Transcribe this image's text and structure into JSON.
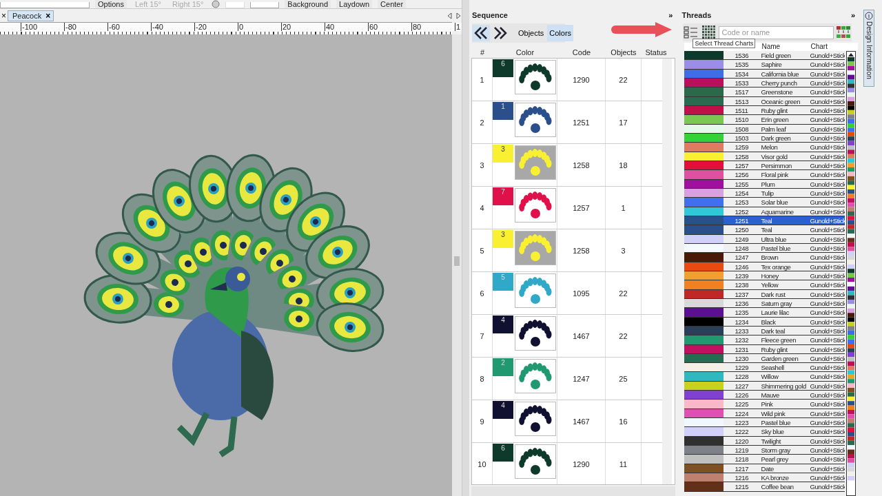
{
  "toolbar": {
    "items": [
      {
        "label": "Options",
        "disabled": false
      },
      {
        "label": "Left 15°",
        "disabled": true
      },
      {
        "label": "Right 15°",
        "disabled": true
      },
      {
        "label": "Background",
        "disabled": false
      },
      {
        "label": "Laydown",
        "disabled": false
      },
      {
        "label": "Center",
        "disabled": false
      }
    ]
  },
  "tab_bar": {
    "overflow_close": "×",
    "tabs": [
      {
        "label": "Peacock",
        "close": "×",
        "selected": true
      }
    ]
  },
  "ruler": {
    "labels": [
      "-100",
      "-80",
      "-60",
      "-40",
      "-20",
      "0",
      "20",
      "40",
      "60",
      "80",
      "1"
    ]
  },
  "sequence": {
    "title": "Sequence",
    "expand": "»",
    "views": [
      {
        "label": "Objects",
        "selected": false
      },
      {
        "label": "Colors",
        "selected": true
      }
    ],
    "columns": [
      "#",
      "Color",
      "Code",
      "Objects",
      "Status"
    ],
    "rows": [
      {
        "number": "1",
        "swatch_label": "6",
        "color": "#0d3a2a",
        "code": "1290",
        "objects": "22",
        "shaded": false
      },
      {
        "number": "2",
        "swatch_label": "1",
        "color": "#2a4f8a",
        "code": "1251",
        "objects": "17",
        "shaded": false
      },
      {
        "number": "3",
        "swatch_label": "3",
        "color": "#f8f030",
        "code": "1258",
        "objects": "18",
        "shaded": true
      },
      {
        "number": "4",
        "swatch_label": "7",
        "color": "#e0104a",
        "code": "1257",
        "objects": "1",
        "shaded": false
      },
      {
        "number": "5",
        "swatch_label": "3",
        "color": "#f8f030",
        "code": "1258",
        "objects": "3",
        "shaded": true
      },
      {
        "number": "6",
        "swatch_label": "5",
        "color": "#30a8c8",
        "code": "1095",
        "objects": "22",
        "shaded": false
      },
      {
        "number": "7",
        "swatch_label": "4",
        "color": "#101030",
        "code": "1467",
        "objects": "22",
        "shaded": false
      },
      {
        "number": "8",
        "swatch_label": "2",
        "color": "#209870",
        "code": "1247",
        "objects": "25",
        "shaded": false
      },
      {
        "number": "9",
        "swatch_label": "4",
        "color": "#101030",
        "code": "1467",
        "objects": "16",
        "shaded": false
      },
      {
        "number": "10",
        "swatch_label": "6",
        "color": "#0d3a2a",
        "code": "1290",
        "objects": "11",
        "shaded": false
      }
    ]
  },
  "threads": {
    "title": "Threads",
    "expand": "»",
    "search": {
      "placeholder": "Code or name"
    },
    "tooltip": "Select Thread Charts",
    "columns": [
      "Name",
      "Chart"
    ],
    "rows": [
      {
        "code": "1536",
        "name": "Field green",
        "chart": "Gunold+Stick",
        "color": "#0d3a2a",
        "selected": false
      },
      {
        "code": "1535",
        "name": "Saphire",
        "chart": "Gunold+Stick",
        "color": "#9a8ee8",
        "selected": false
      },
      {
        "code": "1534",
        "name": "California blue",
        "chart": "Gunold+Stick",
        "color": "#3f6de8",
        "selected": false
      },
      {
        "code": "1533",
        "name": "Cherry punch",
        "chart": "Gunold+Stick",
        "color": "#b8105a",
        "selected": false
      },
      {
        "code": "1517",
        "name": "Greenstone",
        "chart": "Gunold+Stick",
        "color": "#2a6a4a",
        "selected": false
      },
      {
        "code": "1513",
        "name": "Oceanic green",
        "chart": "Gunold+Stick",
        "color": "#2a6a50",
        "selected": false
      },
      {
        "code": "1511",
        "name": "Ruby glint",
        "chart": "Gunold+Stick",
        "color": "#c0104a",
        "selected": false
      },
      {
        "code": "1510",
        "name": "Erin green",
        "chart": "Gunold+Stick",
        "color": "#7ac850",
        "selected": false
      },
      {
        "code": "1508",
        "name": "Palm leaf",
        "chart": "Gunold+Stick",
        "color": "#e6f8ea",
        "selected": false
      },
      {
        "code": "1503",
        "name": "Dark green",
        "chart": "Gunold+Stick",
        "color": "#38d038",
        "selected": false
      },
      {
        "code": "1259",
        "name": "Melon",
        "chart": "Gunold+Stick",
        "color": "#e07a60",
        "selected": false
      },
      {
        "code": "1258",
        "name": "Visor gold",
        "chart": "Gunold+Stick",
        "color": "#f8f030",
        "selected": false
      },
      {
        "code": "1257",
        "name": "Persimmon",
        "chart": "Gunold+Stick",
        "color": "#e0103a",
        "selected": false
      },
      {
        "code": "1256",
        "name": "Floral pink",
        "chart": "Gunold+Stick",
        "color": "#e050a0",
        "selected": false
      },
      {
        "code": "1255",
        "name": "Plum",
        "chart": "Gunold+Stick",
        "color": "#a010a0",
        "selected": false
      },
      {
        "code": "1254",
        "name": "Tulip",
        "chart": "Gunold+Stick",
        "color": "#d8a0e0",
        "selected": false
      },
      {
        "code": "1253",
        "name": "Solar blue",
        "chart": "Gunold+Stick",
        "color": "#4070f0",
        "selected": false
      },
      {
        "code": "1252",
        "name": "Aquamarine",
        "chart": "Gunold+Stick",
        "color": "#30c8d8",
        "selected": false
      },
      {
        "code": "1251",
        "name": "Teal",
        "chart": "Gunold+Stick",
        "color": "#2a4f8a",
        "selected": true
      },
      {
        "code": "1250",
        "name": "Teal",
        "chart": "Gunold+Stick",
        "color": "#2a4f8a",
        "selected": false
      },
      {
        "code": "1249",
        "name": "Ultra blue",
        "chart": "Gunold+Stick",
        "color": "#d0d0f8",
        "selected": false
      },
      {
        "code": "1248",
        "name": "Pastel blue",
        "chart": "Gunold+Stick",
        "color": "#f4f8ff",
        "selected": false
      },
      {
        "code": "1247",
        "name": "Brown",
        "chart": "Gunold+Stick",
        "color": "#4a1a08",
        "selected": false
      },
      {
        "code": "1246",
        "name": "Tex orange",
        "chart": "Gunold+Stick",
        "color": "#e84a10",
        "selected": false
      },
      {
        "code": "1239",
        "name": "Honey",
        "chart": "Gunold+Stick",
        "color": "#f0a030",
        "selected": false
      },
      {
        "code": "1238",
        "name": "Yellow",
        "chart": "Gunold+Stick",
        "color": "#f08020",
        "selected": false
      },
      {
        "code": "1237",
        "name": "Dark rust",
        "chart": "Gunold+Stick",
        "color": "#c02828",
        "selected": false
      },
      {
        "code": "1236",
        "name": "Saturn gray",
        "chart": "Gunold+Stick",
        "color": "#d8d8d8",
        "selected": false
      },
      {
        "code": "1235",
        "name": "Laurie lilac",
        "chart": "Gunold+Stick",
        "color": "#5a1090",
        "selected": false
      },
      {
        "code": "1234",
        "name": "Black",
        "chart": "Gunold+Stick",
        "color": "#000000",
        "selected": false
      },
      {
        "code": "1233",
        "name": "Dark teal",
        "chart": "Gunold+Stick",
        "color": "#2a4058",
        "selected": false
      },
      {
        "code": "1232",
        "name": "Fleece green",
        "chart": "Gunold+Stick",
        "color": "#209870",
        "selected": false
      },
      {
        "code": "1231",
        "name": "Ruby glint",
        "chart": "Gunold+Stick",
        "color": "#c01060",
        "selected": false
      },
      {
        "code": "1230",
        "name": "Garden green",
        "chart": "Gunold+Stick",
        "color": "#2a6a52",
        "selected": false
      },
      {
        "code": "1229",
        "name": "Seashell",
        "chart": "Gunold+Stick",
        "color": "#f4f0e8",
        "selected": false
      },
      {
        "code": "1228",
        "name": "Willow",
        "chart": "Gunold+Stick",
        "color": "#30b8c0",
        "selected": false
      },
      {
        "code": "1227",
        "name": "Shimmering gold",
        "chart": "Gunold+Stick",
        "color": "#c8d020",
        "selected": false
      },
      {
        "code": "1226",
        "name": "Mauve",
        "chart": "Gunold+Stick",
        "color": "#8040d0",
        "selected": false
      },
      {
        "code": "1225",
        "name": "Pink",
        "chart": "Gunold+Stick",
        "color": "#f8b8c8",
        "selected": false
      },
      {
        "code": "1224",
        "name": "Wild pink",
        "chart": "Gunold+Stick",
        "color": "#e050b0",
        "selected": false
      },
      {
        "code": "1223",
        "name": "Pastel blue",
        "chart": "Gunold+Stick",
        "color": "#f0f8fe",
        "selected": false
      },
      {
        "code": "1222",
        "name": "Sky blue",
        "chart": "Gunold+Stick",
        "color": "#d0d0fa",
        "selected": false
      },
      {
        "code": "1220",
        "name": "Twilight",
        "chart": "Gunold+Stick",
        "color": "#303030",
        "selected": false
      },
      {
        "code": "1219",
        "name": "Storm gray",
        "chart": "Gunold+Stick",
        "color": "#808088",
        "selected": false
      },
      {
        "code": "1218",
        "name": "Pearl grey",
        "chart": "Gunold+Stick",
        "color": "#c0c0c0",
        "selected": false
      },
      {
        "code": "1217",
        "name": "Date",
        "chart": "Gunold+Stick",
        "color": "#805020",
        "selected": false
      },
      {
        "code": "1216",
        "name": "KA bronze",
        "chart": "Gunold+Stick",
        "color": "#c08070",
        "selected": false
      },
      {
        "code": "1215",
        "name": "Coffee bean",
        "chart": "Gunold+Stick",
        "color": "#603018",
        "selected": false
      }
    ]
  },
  "side_tab": {
    "label": "Design Information"
  }
}
